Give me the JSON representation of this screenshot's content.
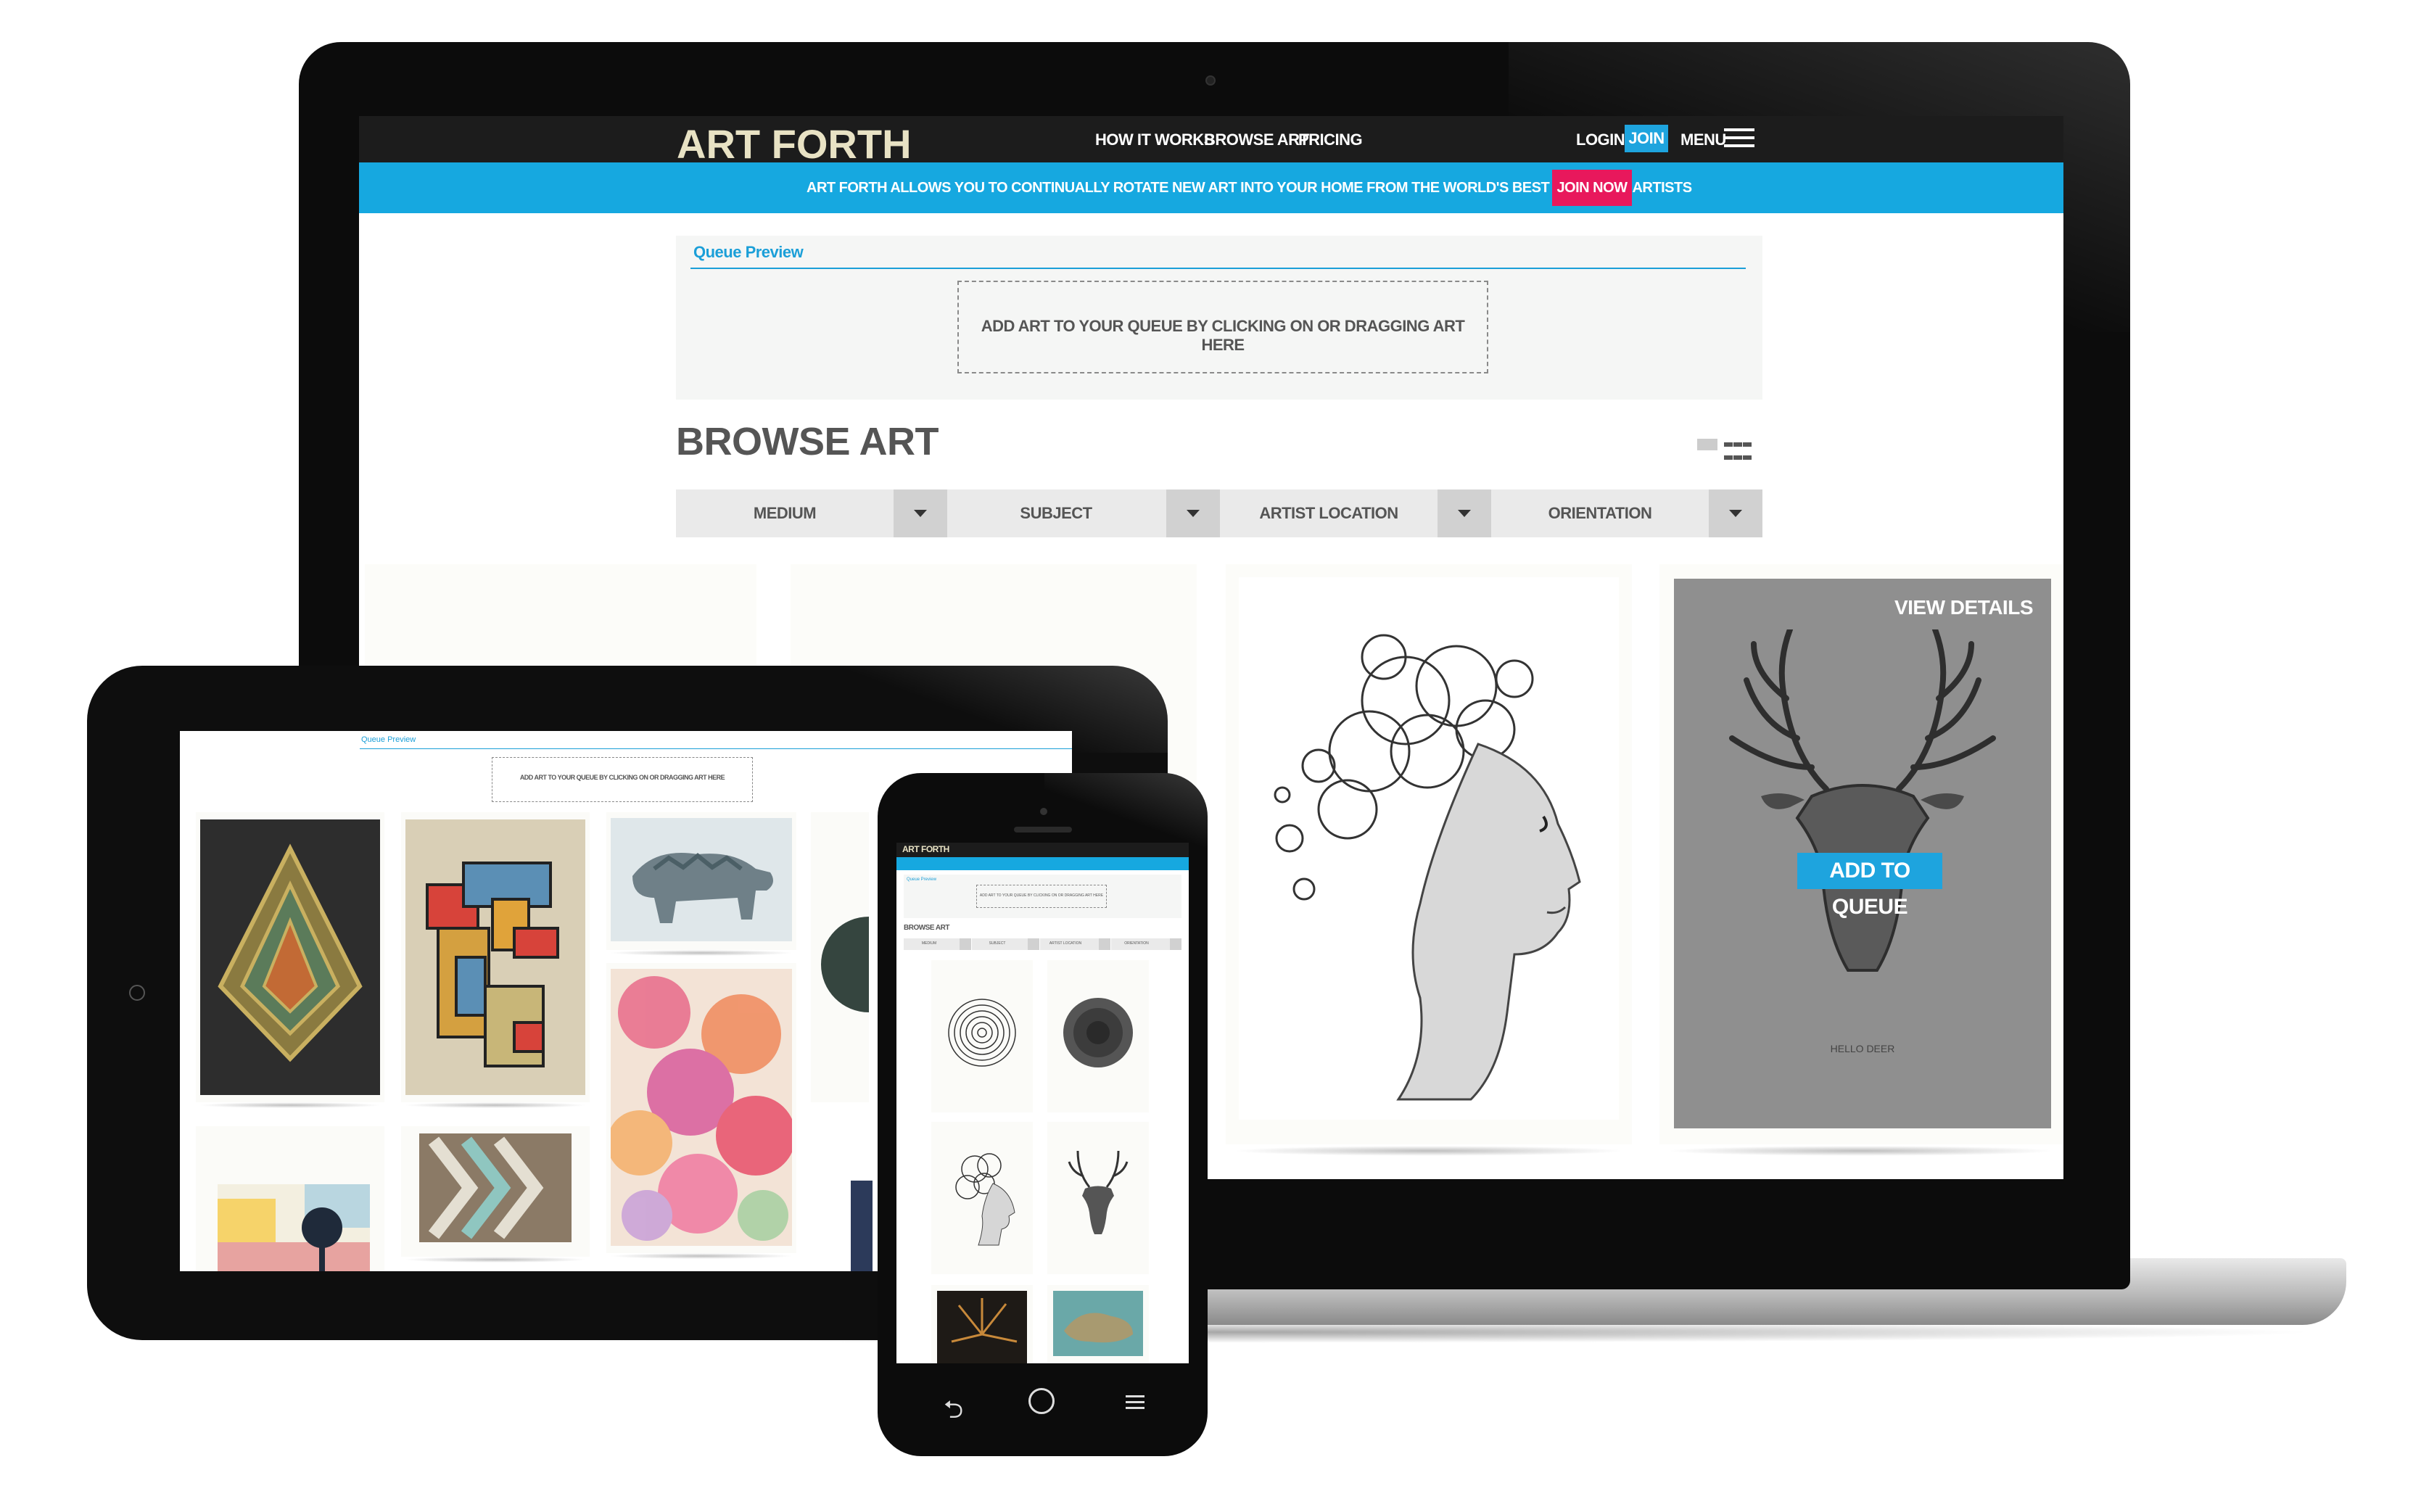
{
  "laptop": {
    "nav": {
      "logo": "ART FORTH",
      "links": [
        "HOW IT WORKS",
        "BROWSE ART",
        "PRICING"
      ],
      "login": "LOGIN",
      "join": "JOIN",
      "menu": "MENU"
    },
    "banner": {
      "text": "ART FORTH ALLOWS YOU TO CONTINUALLY ROTATE NEW ART INTO YOUR HOME FROM THE WORLD'S BEST EMERGING ARTISTS",
      "button": "JOIN NOW"
    },
    "queue": {
      "title": "Queue Preview",
      "drop_text": "ADD ART TO YOUR QUEUE BY CLICKING ON OR DRAGGING ART HERE"
    },
    "browse_title": "BROWSE ART",
    "filters": [
      "MEDIUM",
      "SUBJECT",
      "ARTIST LOCATION",
      "ORIENTATION"
    ],
    "card_overlay": {
      "view_details": "VIEW DETAILS",
      "add_to_queue": "ADD TO QUEUE",
      "caption": "HELLO DEER"
    }
  },
  "tablet": {
    "queue": {
      "title": "Queue Preview",
      "drop_text": "ADD ART TO YOUR QUEUE BY CLICKING ON OR DRAGGING ART HERE"
    }
  },
  "phone": {
    "logo": "ART FORTH",
    "queue_title": "Queue Preview",
    "drop_text": "ADD ART TO YOUR QUEUE BY CLICKING ON OR DRAGGING ART HERE",
    "browse_title": "BROWSE ART",
    "filters": [
      "MEDIUM",
      "SUBJECT",
      "ARTIST LOCATION",
      "ORIENTATION"
    ],
    "nav_icons": [
      "back-icon",
      "power-icon",
      "menu-icon"
    ]
  },
  "colors": {
    "accent_blue": "#16a8e0",
    "join_pink": "#e8185c",
    "nav_dark": "#1c1c1c",
    "logo_cream": "#e8e2c4"
  }
}
